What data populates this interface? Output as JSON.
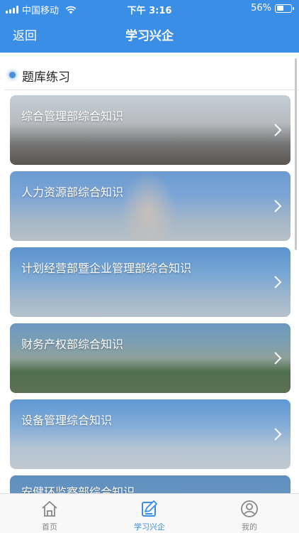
{
  "status": {
    "carrier": "中国移动",
    "time": "下午 3:16",
    "battery": "56%",
    "battery_level": 0.56
  },
  "nav": {
    "back_label": "返回",
    "title": "学习兴企"
  },
  "section": {
    "title": "题库练习"
  },
  "cards": [
    {
      "label": "综合管理部综合知识",
      "icon": "chevron-right-icon"
    },
    {
      "label": "人力资源部综合知识",
      "icon": "chevron-right-icon"
    },
    {
      "label": "计划经营部暨企业管理部综合知识",
      "icon": "chevron-right-icon"
    },
    {
      "label": "财务产权部综合知识",
      "icon": "chevron-right-icon"
    },
    {
      "label": "设备管理综合知识",
      "icon": "chevron-right-icon"
    },
    {
      "label": "安健环监察部综合知识",
      "icon": "chevron-right-icon"
    }
  ],
  "tabs": [
    {
      "label": "首页",
      "icon": "home-icon",
      "active": false
    },
    {
      "label": "学习兴企",
      "icon": "study-edit-icon",
      "active": true
    },
    {
      "label": "我的",
      "icon": "user-icon",
      "active": false
    }
  ],
  "colors": {
    "primary": "#3a8ee6",
    "tab_inactive": "#888888"
  }
}
